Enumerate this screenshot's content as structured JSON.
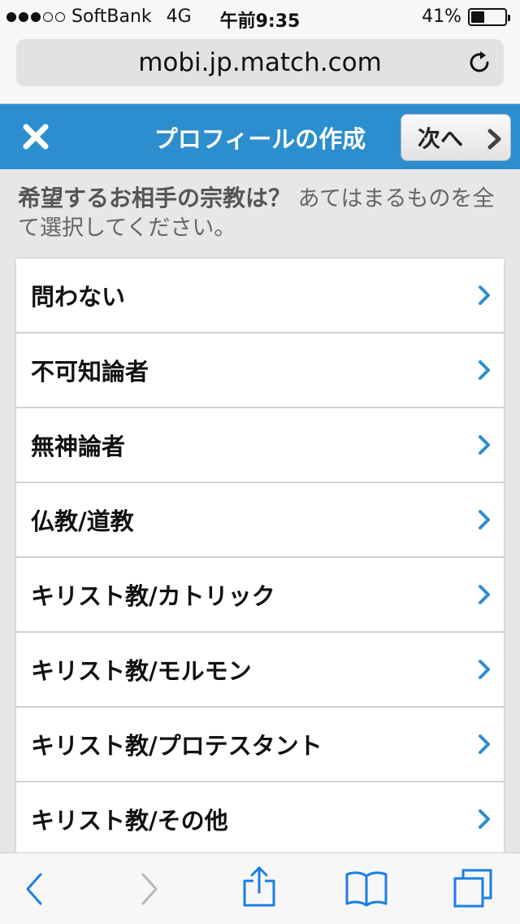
{
  "status": {
    "carrier": "SoftBank",
    "network": "4G",
    "time": "午前9:35",
    "battery_text": "41%",
    "battery_level": 0.41,
    "signal_filled": 3,
    "signal_total": 5
  },
  "browser": {
    "url": "mobi.jp.match.com"
  },
  "header": {
    "title": "プロフィールの作成",
    "next_label": "次へ",
    "accent_color": "#2c8ece"
  },
  "question": {
    "main": "希望するお相手の宗教は？",
    "sub": " あてはまるものを全て選択してください。"
  },
  "options": [
    {
      "label": "問わない"
    },
    {
      "label": "不可知論者"
    },
    {
      "label": "無神論者"
    },
    {
      "label": "仏教/道教"
    },
    {
      "label": "キリスト教/カトリック"
    },
    {
      "label": "キリスト教/モルモン"
    },
    {
      "label": "キリスト教/プロテスタント"
    },
    {
      "label": "キリスト教/その他"
    }
  ],
  "toolbar": {
    "icons": [
      "back-icon",
      "forward-icon",
      "share-icon",
      "bookmarks-icon",
      "tabs-icon"
    ]
  }
}
